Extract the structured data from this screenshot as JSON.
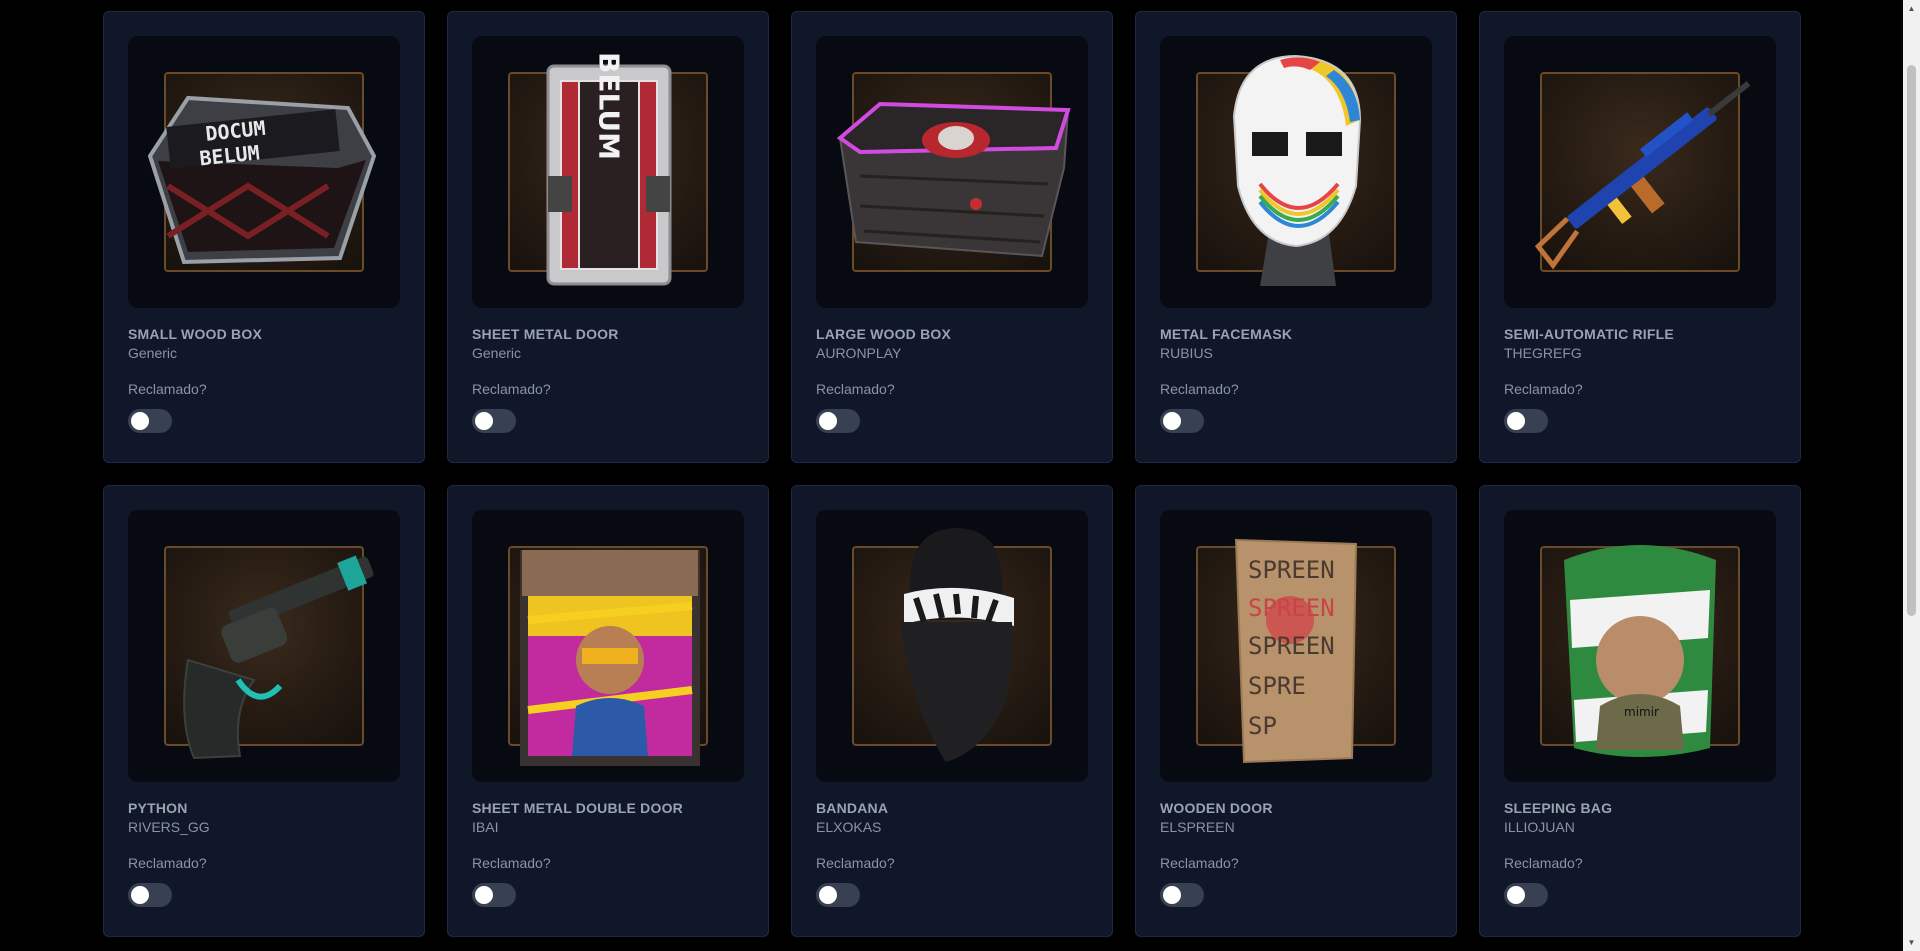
{
  "claim_label": "Reclamado?",
  "items": [
    {
      "name": "SMALL WOOD BOX",
      "creator": "Generic",
      "claimed": false,
      "art": "small-wood-box"
    },
    {
      "name": "SHEET METAL DOOR",
      "creator": "Generic",
      "claimed": false,
      "art": "sheet-metal-door"
    },
    {
      "name": "LARGE WOOD BOX",
      "creator": "AURONPLAY",
      "claimed": false,
      "art": "large-wood-box"
    },
    {
      "name": "METAL FACEMASK",
      "creator": "RUBIUS",
      "claimed": false,
      "art": "metal-facemask"
    },
    {
      "name": "SEMI-AUTOMATIC RIFLE",
      "creator": "THEGREFG",
      "claimed": false,
      "art": "semi-automatic-rifle"
    },
    {
      "name": "PYTHON",
      "creator": "RIVERS_GG",
      "claimed": false,
      "art": "python-revolver"
    },
    {
      "name": "SHEET METAL DOUBLE DOOR",
      "creator": "IBAI",
      "claimed": false,
      "art": "sheet-metal-double-door"
    },
    {
      "name": "BANDANA",
      "creator": "ELXOKAS",
      "claimed": false,
      "art": "bandana"
    },
    {
      "name": "WOODEN DOOR",
      "creator": "ELSPREEN",
      "claimed": false,
      "art": "wooden-door"
    },
    {
      "name": "SLEEPING BAG",
      "creator": "ILLIOJUAN",
      "claimed": false,
      "art": "sleeping-bag"
    }
  ],
  "art_text": {
    "small_wood_box_line1": "DOCUM",
    "small_wood_box_line2": "BELUM",
    "sheet_metal_door_vertical": "BELUM",
    "sleeping_bag_tag": "mimir",
    "wooden_door_words": [
      "SPREEN",
      "SPREEN",
      "SPREEN",
      "SPRE",
      "SP"
    ]
  }
}
